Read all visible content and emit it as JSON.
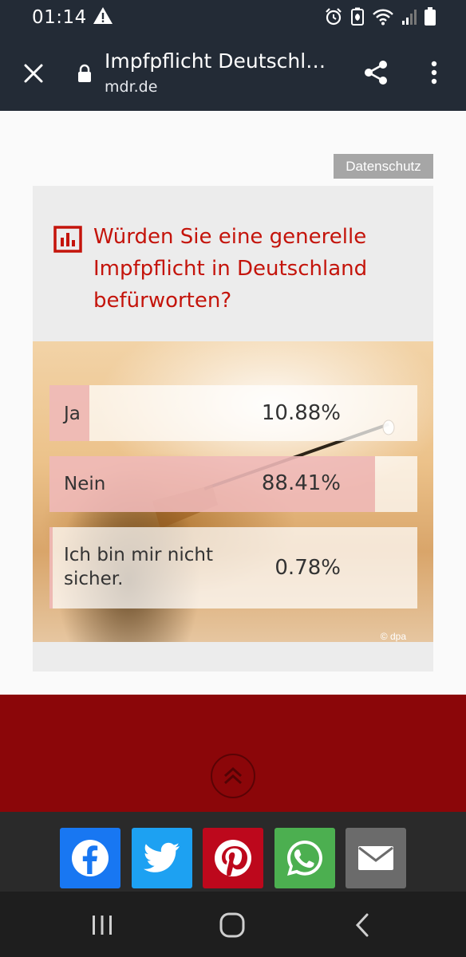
{
  "status_bar": {
    "time": "01:14",
    "icons": [
      "alert-icon",
      "alarm-icon",
      "battery-saver-icon",
      "wifi-icon",
      "signal-icon",
      "battery-icon"
    ]
  },
  "browser": {
    "page_title": "Impfpflicht Deutschland",
    "domain": "mdr.de",
    "colors": {
      "toolbar_bg": "#232b36"
    }
  },
  "privacy_button": "Datenschutz",
  "poll": {
    "question": "Würden Sie eine generelle Impfpflicht in Deutschland befürworten?",
    "image_credit": "© dpa",
    "accent_color": "#c4140b",
    "options": [
      {
        "label": "Ja",
        "percent_text": "10.88%",
        "percent": 10.88
      },
      {
        "label": "Nein",
        "percent_text": "88.41%",
        "percent": 88.41
      },
      {
        "label": "Ich bin mir nicht sicher.",
        "percent_text": "0.78%",
        "percent": 0.78
      }
    ]
  },
  "footer_band": {
    "color": "#8b0609",
    "icon": "scroll-to-top-icon"
  },
  "share_bar": {
    "items": [
      {
        "name": "facebook",
        "color": "#1877f2",
        "icon": "facebook-icon"
      },
      {
        "name": "twitter",
        "color": "#1da1f2",
        "icon": "twitter-icon"
      },
      {
        "name": "pinterest",
        "color": "#bd081c",
        "icon": "pinterest-icon"
      },
      {
        "name": "whatsapp",
        "color": "#4caf50",
        "icon": "whatsapp-icon"
      },
      {
        "name": "email",
        "color": "#6b6b6b",
        "icon": "mail-icon"
      }
    ]
  },
  "nav_bar": {
    "icons": [
      "recent-apps-icon",
      "home-icon",
      "back-icon"
    ]
  }
}
